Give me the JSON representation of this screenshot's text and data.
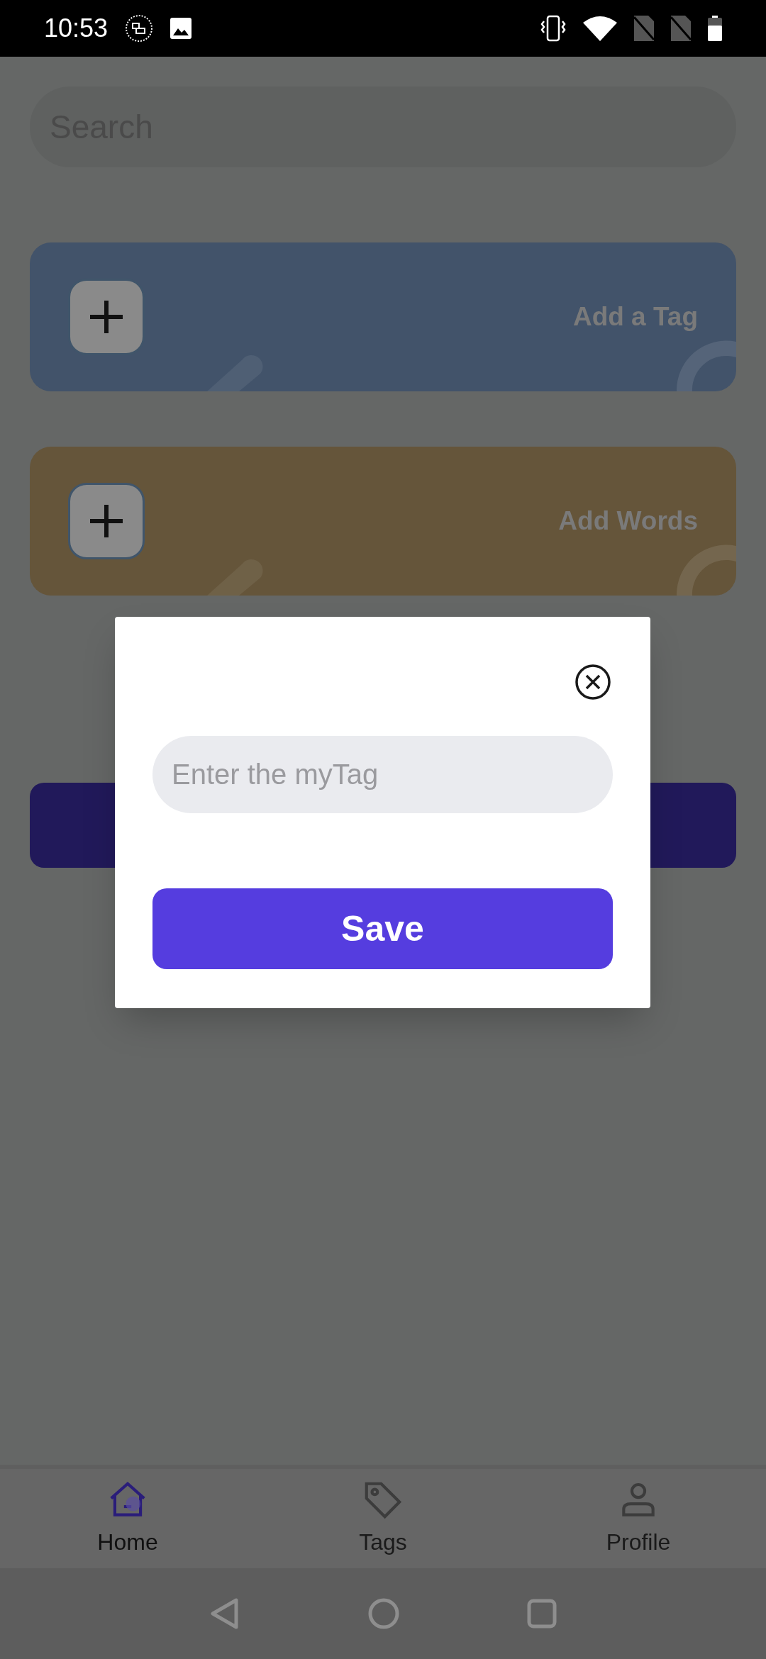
{
  "status_bar": {
    "time": "10:53"
  },
  "search": {
    "placeholder": "Search"
  },
  "cards": [
    {
      "label": "Add a Tag",
      "color": "#42536a"
    },
    {
      "label": "Add Words",
      "color": "#65553a"
    }
  ],
  "dialog": {
    "input": {
      "placeholder": "Enter the myTag"
    },
    "save_button": "Save"
  },
  "nav_items": [
    {
      "label": "Home",
      "kind": "home",
      "selected": true
    },
    {
      "label": "Tags",
      "kind": "tag",
      "selected": false
    },
    {
      "label": "Profile",
      "kind": "person",
      "selected": false
    }
  ]
}
